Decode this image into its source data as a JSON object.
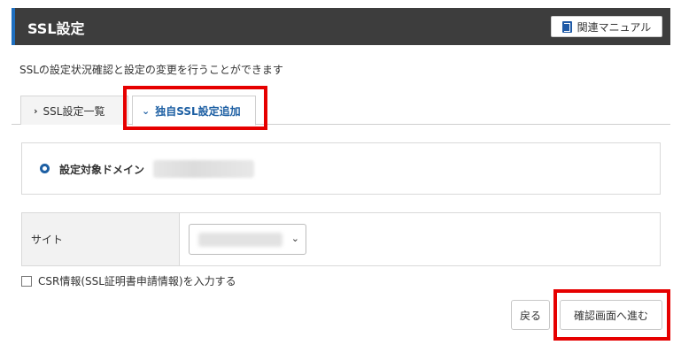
{
  "header": {
    "title": "SSL設定",
    "manual_label": "関連マニュアル",
    "accent_color": "#1f6fbf"
  },
  "description": "SSLの設定状況確認と設定の変更を行うことができます",
  "tabs": [
    {
      "label": "SSL設定一覧",
      "icon": "chevron-right-icon",
      "active": false
    },
    {
      "label": "独自SSL設定追加",
      "icon": "chevron-down-icon",
      "active": true
    }
  ],
  "domain": {
    "label": "設定対象ドメイン",
    "value_blurred": true
  },
  "site": {
    "label": "サイト",
    "value_blurred": true
  },
  "csr": {
    "label": "CSR情報(SSL証明書申請情報)を入力する",
    "checked": false
  },
  "buttons": {
    "back": "戻る",
    "confirm": "確認画面へ進む"
  },
  "highlight_color": "#e60000"
}
